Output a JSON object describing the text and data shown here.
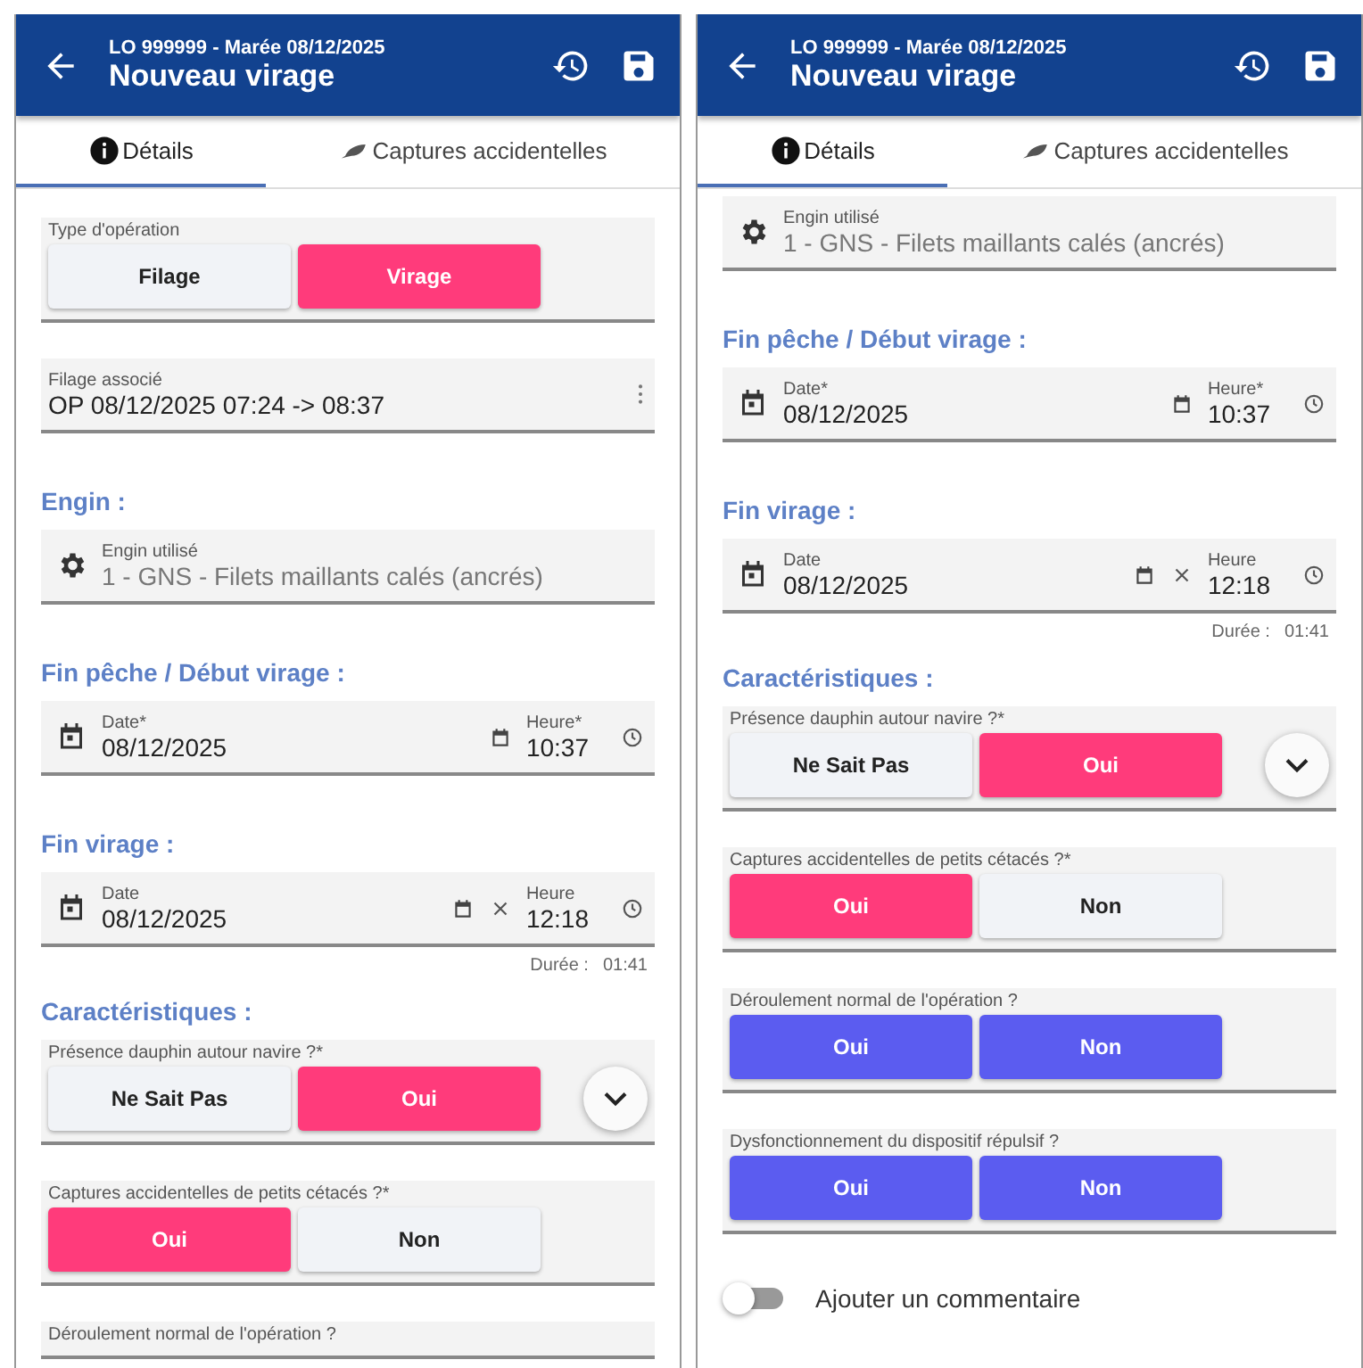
{
  "screens": [
    {
      "header": {
        "subtitle": "LO 999999 - Marée 08/12/2025",
        "title": "Nouveau virage"
      },
      "tabs": [
        {
          "label": "Détails",
          "selected": true
        },
        {
          "label": "Captures accidentelles",
          "selected": false
        }
      ],
      "items": [
        {
          "kind": "choice",
          "label": "Type d'opération",
          "answered": true,
          "options": [
            {
              "label": "Filage",
              "selected": false
            },
            {
              "label": "Virage",
              "selected": true
            }
          ]
        },
        {
          "kind": "select",
          "label": "Filage associé",
          "value": "OP 08/12/2025 07:24  -> 08:37"
        },
        {
          "kind": "heading",
          "text": "Engin :"
        },
        {
          "kind": "gear_field",
          "label": "Engin utilisé",
          "value": "1 - GNS - Filets maillants calés (ancrés)",
          "disabled": true
        },
        {
          "kind": "heading",
          "text": "Fin pêche / Début virage :"
        },
        {
          "kind": "datetime",
          "date_label": "Date*",
          "date": "08/12/2025",
          "time_label": "Heure*",
          "time": "10:37",
          "clearable": false
        },
        {
          "kind": "heading",
          "text": "Fin virage :"
        },
        {
          "kind": "datetime",
          "date_label": "Date",
          "date": "08/12/2025",
          "time_label": "Heure",
          "time": "12:18",
          "clearable": true
        },
        {
          "kind": "duration",
          "label": "Durée :",
          "value": "01:41"
        },
        {
          "kind": "heading",
          "text": "Caractéristiques :"
        },
        {
          "kind": "choice",
          "label": "Présence dauphin autour navire ?*",
          "answered": true,
          "expand_button": true,
          "options": [
            {
              "label": "Ne Sait Pas",
              "selected": false
            },
            {
              "label": "Oui",
              "selected": true
            }
          ]
        },
        {
          "kind": "choice",
          "label": "Captures accidentelles de petits cétacés ?*",
          "answered": true,
          "options": [
            {
              "label": "Oui",
              "selected": true
            },
            {
              "label": "Non",
              "selected": false
            }
          ]
        },
        {
          "kind": "choice",
          "label": "Déroulement normal de l'opération ?"
        }
      ]
    },
    {
      "header": {
        "subtitle": "LO 999999 - Marée 08/12/2025",
        "title": "Nouveau virage"
      },
      "tabs": [
        {
          "label": "Détails",
          "selected": true
        },
        {
          "label": "Captures accidentelles",
          "selected": false
        }
      ],
      "items": [
        {
          "kind": "gear_field",
          "label": "Engin utilisé",
          "value": "1 - GNS - Filets maillants calés (ancrés)",
          "disabled": true
        },
        {
          "kind": "heading",
          "text": "Fin pêche / Début virage :"
        },
        {
          "kind": "datetime",
          "date_label": "Date*",
          "date": "08/12/2025",
          "time_label": "Heure*",
          "time": "10:37",
          "clearable": false
        },
        {
          "kind": "heading",
          "text": "Fin virage :"
        },
        {
          "kind": "datetime",
          "date_label": "Date",
          "date": "08/12/2025",
          "time_label": "Heure",
          "time": "12:18",
          "clearable": true
        },
        {
          "kind": "duration",
          "label": "Durée :",
          "value": "01:41"
        },
        {
          "kind": "heading",
          "text": "Caractéristiques :"
        },
        {
          "kind": "choice",
          "label": "Présence dauphin autour navire ?*",
          "answered": true,
          "expand_button": true,
          "options": [
            {
              "label": "Ne Sait Pas",
              "selected": false
            },
            {
              "label": "Oui",
              "selected": true
            }
          ]
        },
        {
          "kind": "choice",
          "label": "Captures accidentelles de petits cétacés ?*",
          "answered": true,
          "options": [
            {
              "label": "Oui",
              "selected": true
            },
            {
              "label": "Non",
              "selected": false
            }
          ]
        },
        {
          "kind": "choice",
          "label": "Déroulement normal de l'opération ?",
          "answered": false,
          "options": [
            {
              "label": "Oui"
            },
            {
              "label": "Non"
            }
          ]
        },
        {
          "kind": "choice",
          "label": "Dysfonctionnement du dispositif répulsif ?",
          "answered": false,
          "options": [
            {
              "label": "Oui"
            },
            {
              "label": "Non"
            }
          ]
        },
        {
          "kind": "toggle",
          "label": "Ajouter un commentaire",
          "on": false
        }
      ]
    }
  ]
}
